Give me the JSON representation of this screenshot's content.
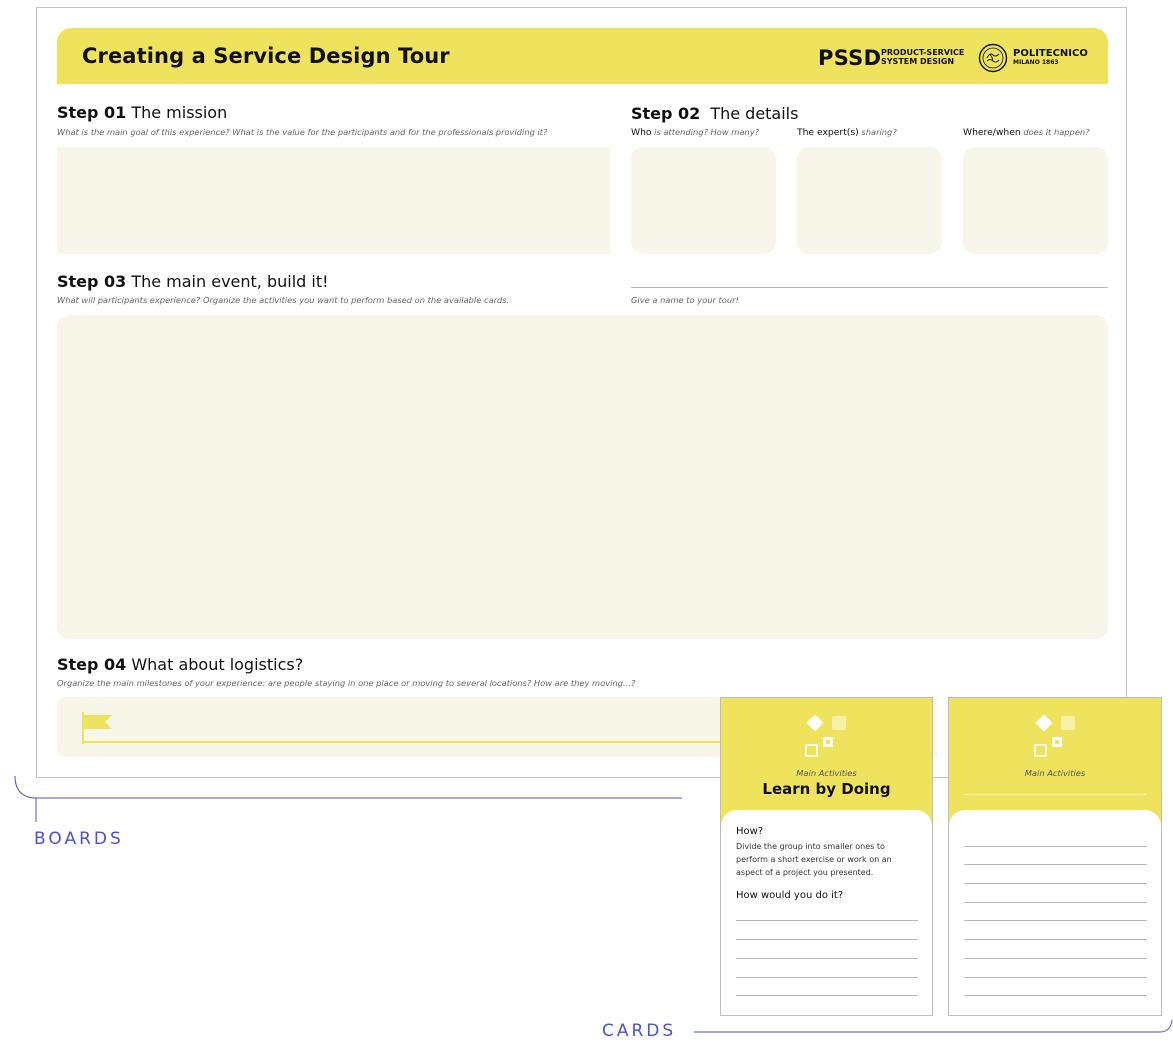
{
  "board": {
    "title": "Creating a Service Design Tour",
    "logo_pssd": "PSSD",
    "logo_pssd_sub": [
      "PRODUCT-SERVICE",
      "SYSTEM DESIGN"
    ],
    "logo_poli": "POLITECNICO",
    "logo_poli_sub": "MILANO 1863",
    "step01": {
      "num": "Step 01",
      "title": "The mission",
      "question": "What is the main goal of this experience? What is the value for the participants and for the professionals providing it?"
    },
    "step02": {
      "num": "Step 02",
      "title": "The details",
      "who_label": "Who",
      "who_q": "is attending? How many?",
      "expert_label": "The expert(s)",
      "expert_q": "sharing?",
      "where_label": "Where/when",
      "where_q": "does it happen?"
    },
    "step03": {
      "num": "Step 03",
      "title": "The main event, build it!",
      "question": "What will participants experience? Organize the activities you want to perform based on the available cards.",
      "name_prompt": "Give a name to your tour!"
    },
    "step04": {
      "num": "Step 04",
      "title": "What about logistics?",
      "question": "Organize the main milestones of your experience: are people staying in one place or moving to several locations? How are they moving...?"
    }
  },
  "cards": [
    {
      "category": "Main Activities",
      "name": "Learn by Doing",
      "how_label": "How?",
      "how_text": "Divide the group into smaller ones to perform a short exercise or work on an aspect of a project you presented.",
      "prompt": "How would you do it?"
    },
    {
      "category": "Main Activities"
    }
  ],
  "labels": {
    "boards": "BOARDS",
    "cards": "CARDS"
  },
  "colors": {
    "yellow": "#efe35e",
    "cream": "#f8f6e8",
    "accent_blue": "#4a55c9"
  }
}
